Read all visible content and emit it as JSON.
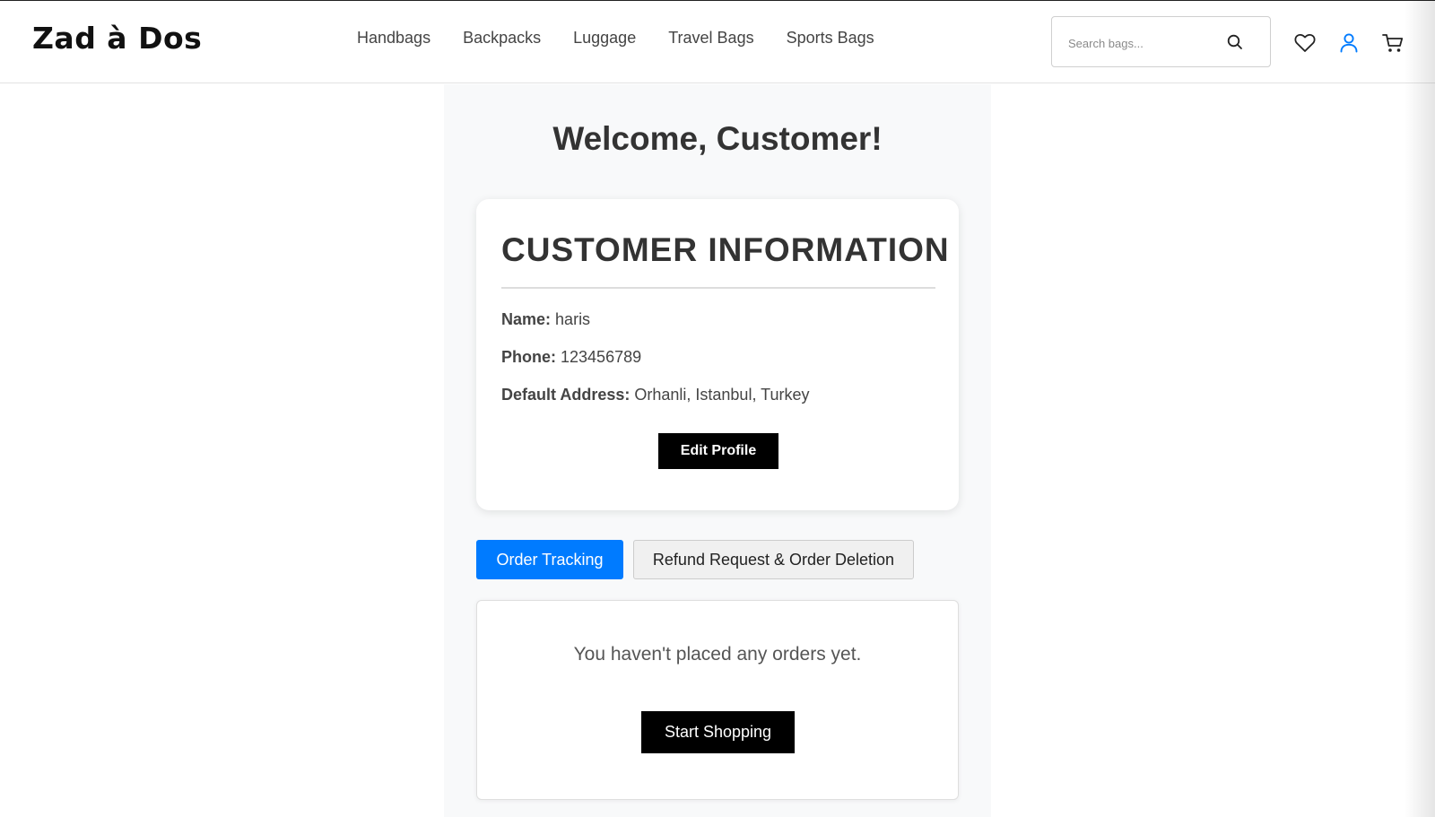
{
  "header": {
    "logo": "Zad à Dos",
    "nav": [
      "Handbags",
      "Backpacks",
      "Luggage",
      "Travel Bags",
      "Sports Bags"
    ],
    "search": {
      "placeholder": "Search bags...",
      "value": "",
      "icon": "search-icon"
    },
    "icons": [
      "heart-icon",
      "user-icon",
      "cart-icon"
    ],
    "user_icon_color": "#007bff"
  },
  "main": {
    "welcome": "Welcome, Customer!",
    "card": {
      "title": "CUSTOMER INFORMATION",
      "name_label": "Name:",
      "name_value": "haris",
      "phone_label": "Phone:",
      "phone_value": "123456789",
      "address_label": "Default Address:",
      "address_value": "Orhanli, Istanbul, Turkey",
      "edit_button": "Edit Profile"
    },
    "tabs": [
      {
        "label": "Order Tracking",
        "active": true
      },
      {
        "label": "Refund Request & Order Deletion",
        "active": false
      }
    ],
    "orders": {
      "empty_message": "You haven't placed any orders yet.",
      "shop_button": "Start Shopping"
    }
  },
  "colors": {
    "accent": "#007bff",
    "button_dark": "#000000",
    "panel_bg": "#f8f9fa"
  }
}
